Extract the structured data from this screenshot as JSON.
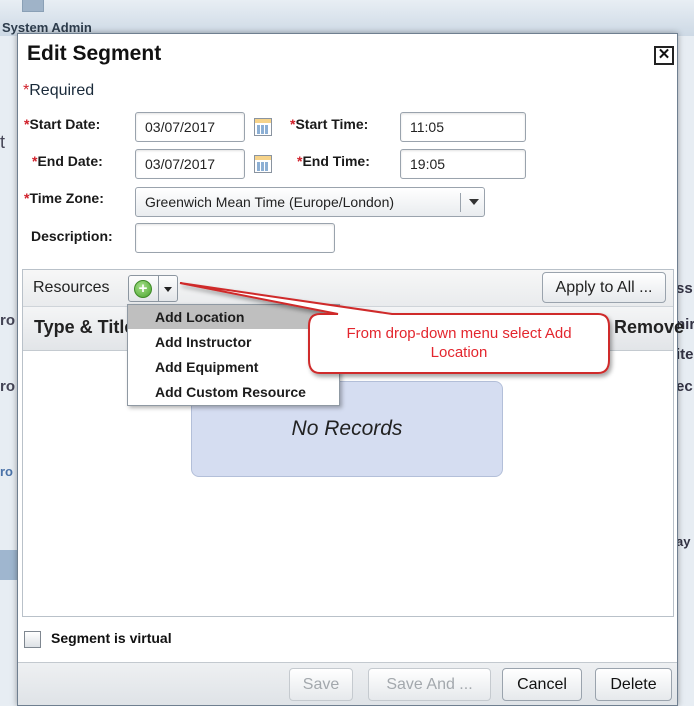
{
  "background": {
    "admin_label": "System Admin",
    "left_fragments": [
      "t",
      "ro",
      "ro",
      "ro"
    ],
    "right_fragments": [
      "ss",
      "nir",
      "ite",
      "ec",
      "ay"
    ]
  },
  "dialog": {
    "title": "Edit Segment",
    "close_icon": "close-icon",
    "required_mark": "*",
    "required_note": "Required",
    "form": {
      "start_date_label": "Start Date:",
      "start_date_value": "03/07/2017",
      "end_date_label": "End Date:",
      "end_date_value": "03/07/2017",
      "start_time_label": "Start Time:",
      "start_time_value": "11:05",
      "end_time_label": "End Time:",
      "end_time_value": "19:05",
      "time_zone_label": "Time Zone:",
      "time_zone_value": "Greenwich Mean Time (Europe/London)",
      "description_label": "Description:",
      "description_value": ""
    },
    "resources": {
      "label": "Resources",
      "apply_all_label": "Apply to All ...",
      "columns": {
        "type_title": "Type & Title",
        "remove": "Remove"
      },
      "empty_text": "No Records",
      "menu_items": [
        "Add Location",
        "Add Instructor",
        "Add Equipment",
        "Add Custom Resource"
      ],
      "highlighted_index": 0
    },
    "virtual_label": "Segment is virtual",
    "virtual_checked": false,
    "footer": {
      "save": "Save",
      "save_and": "Save And ...",
      "cancel": "Cancel",
      "delete": "Delete"
    }
  },
  "annotation": {
    "text": "From drop-down menu select Add Location",
    "color": "#e3262e"
  },
  "colors": {
    "required": "#d0202a",
    "menu_highlight": "#bfbfbf",
    "empty_panel": "#d5ddf1"
  }
}
